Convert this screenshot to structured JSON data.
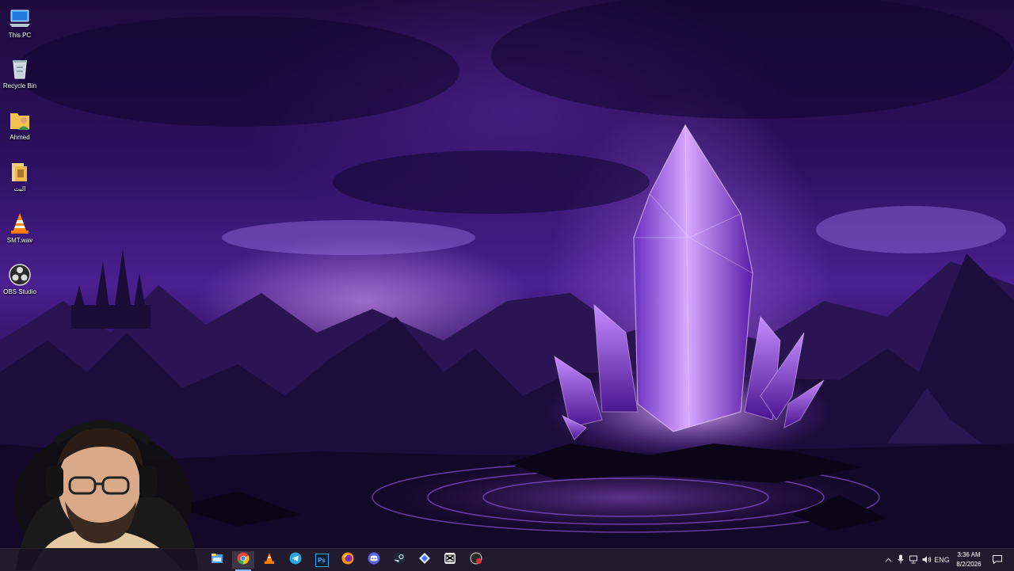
{
  "desktop": {
    "icons": [
      {
        "label": "This PC",
        "icon": "this-pc-icon"
      },
      {
        "label": "Recycle Bin",
        "icon": "recycle-bin-icon"
      },
      {
        "label": "Ahmed",
        "icon": "user-folder-icon"
      },
      {
        "label": "البث",
        "icon": "folder-icon"
      },
      {
        "label": "SMT.wav",
        "icon": "vlc-cone-icon"
      },
      {
        "label": "OBS Studio",
        "icon": "obs-icon"
      }
    ]
  },
  "taskbar": {
    "apps": [
      {
        "name": "File Explorer",
        "icon": "file-explorer-icon"
      },
      {
        "name": "Google Chrome",
        "icon": "chrome-icon",
        "active": true
      },
      {
        "name": "VLC media player",
        "icon": "vlc-icon"
      },
      {
        "name": "Telegram",
        "icon": "telegram-icon"
      },
      {
        "name": "Photoshop",
        "icon": "photoshop-icon",
        "text": "Ps"
      },
      {
        "name": "Firefox",
        "icon": "firefox-icon"
      },
      {
        "name": "Discord",
        "icon": "discord-icon"
      },
      {
        "name": "Steam",
        "icon": "steam-icon"
      },
      {
        "name": "App",
        "icon": "diamond-app-icon"
      },
      {
        "name": "CapCut",
        "icon": "capcut-icon"
      },
      {
        "name": "Recorder",
        "icon": "recorder-icon"
      }
    ],
    "tray": {
      "language": "ENG",
      "time": "3:36 AM",
      "date": "8/2/2026"
    }
  },
  "colors": {
    "taskbar_bg": "#18122a",
    "accent": "#8ab4f8",
    "sky_top": "#1e0b3d",
    "crystal_glow": "#c07dff"
  }
}
